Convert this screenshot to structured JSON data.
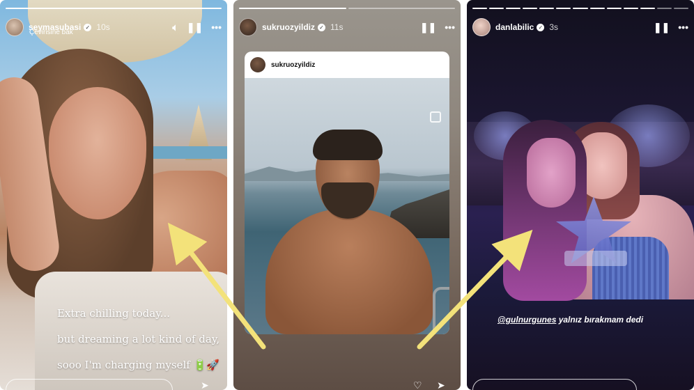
{
  "stories": [
    {
      "username": "seymasubasi",
      "time": "10s",
      "translate_label": "Çevirisine bak",
      "caption_lines": [
        "Extra chilling today...",
        "but dreaming a lot kind of day,",
        "sooo I'm charging myself 🔋🚀"
      ],
      "icons": [
        "sound-icon",
        "pause-icon",
        "more-icon"
      ]
    },
    {
      "username": "sukruozyildiz",
      "time": "11s",
      "shared_post_username": "sukruozyildiz",
      "icons": [
        "pause-icon",
        "more-icon"
      ]
    },
    {
      "username": "danlabilic",
      "time": "3s",
      "caption_mention": "@gulnurgunes",
      "caption_text": " yalnız bırakmam dedi",
      "icons": [
        "pause-icon",
        "more-icon"
      ]
    }
  ],
  "colors": {
    "arrow": "#f3e27a",
    "verified_badge": "#ffffff"
  }
}
